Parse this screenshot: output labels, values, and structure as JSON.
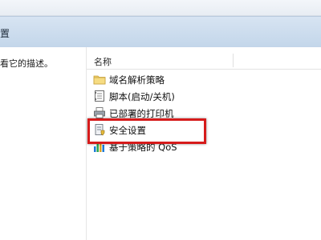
{
  "window": {
    "title_partial": "置"
  },
  "left_pane": {
    "description_partial": "看它的描述。"
  },
  "list": {
    "column_header": "名称",
    "items": [
      {
        "label": "域名解析策略",
        "icon": "folder-icon"
      },
      {
        "label": "脚本(启动/关机)",
        "icon": "script-icon"
      },
      {
        "label": "已部署的打印机",
        "icon": "printer-icon"
      },
      {
        "label": "安全设置",
        "icon": "security-settings-icon",
        "highlighted": true
      },
      {
        "label": "基于策略的 QoS",
        "icon": "qos-chart-icon"
      }
    ]
  },
  "colors": {
    "highlight_border": "#d61b1b",
    "titlebar": "#c3d6ea"
  }
}
